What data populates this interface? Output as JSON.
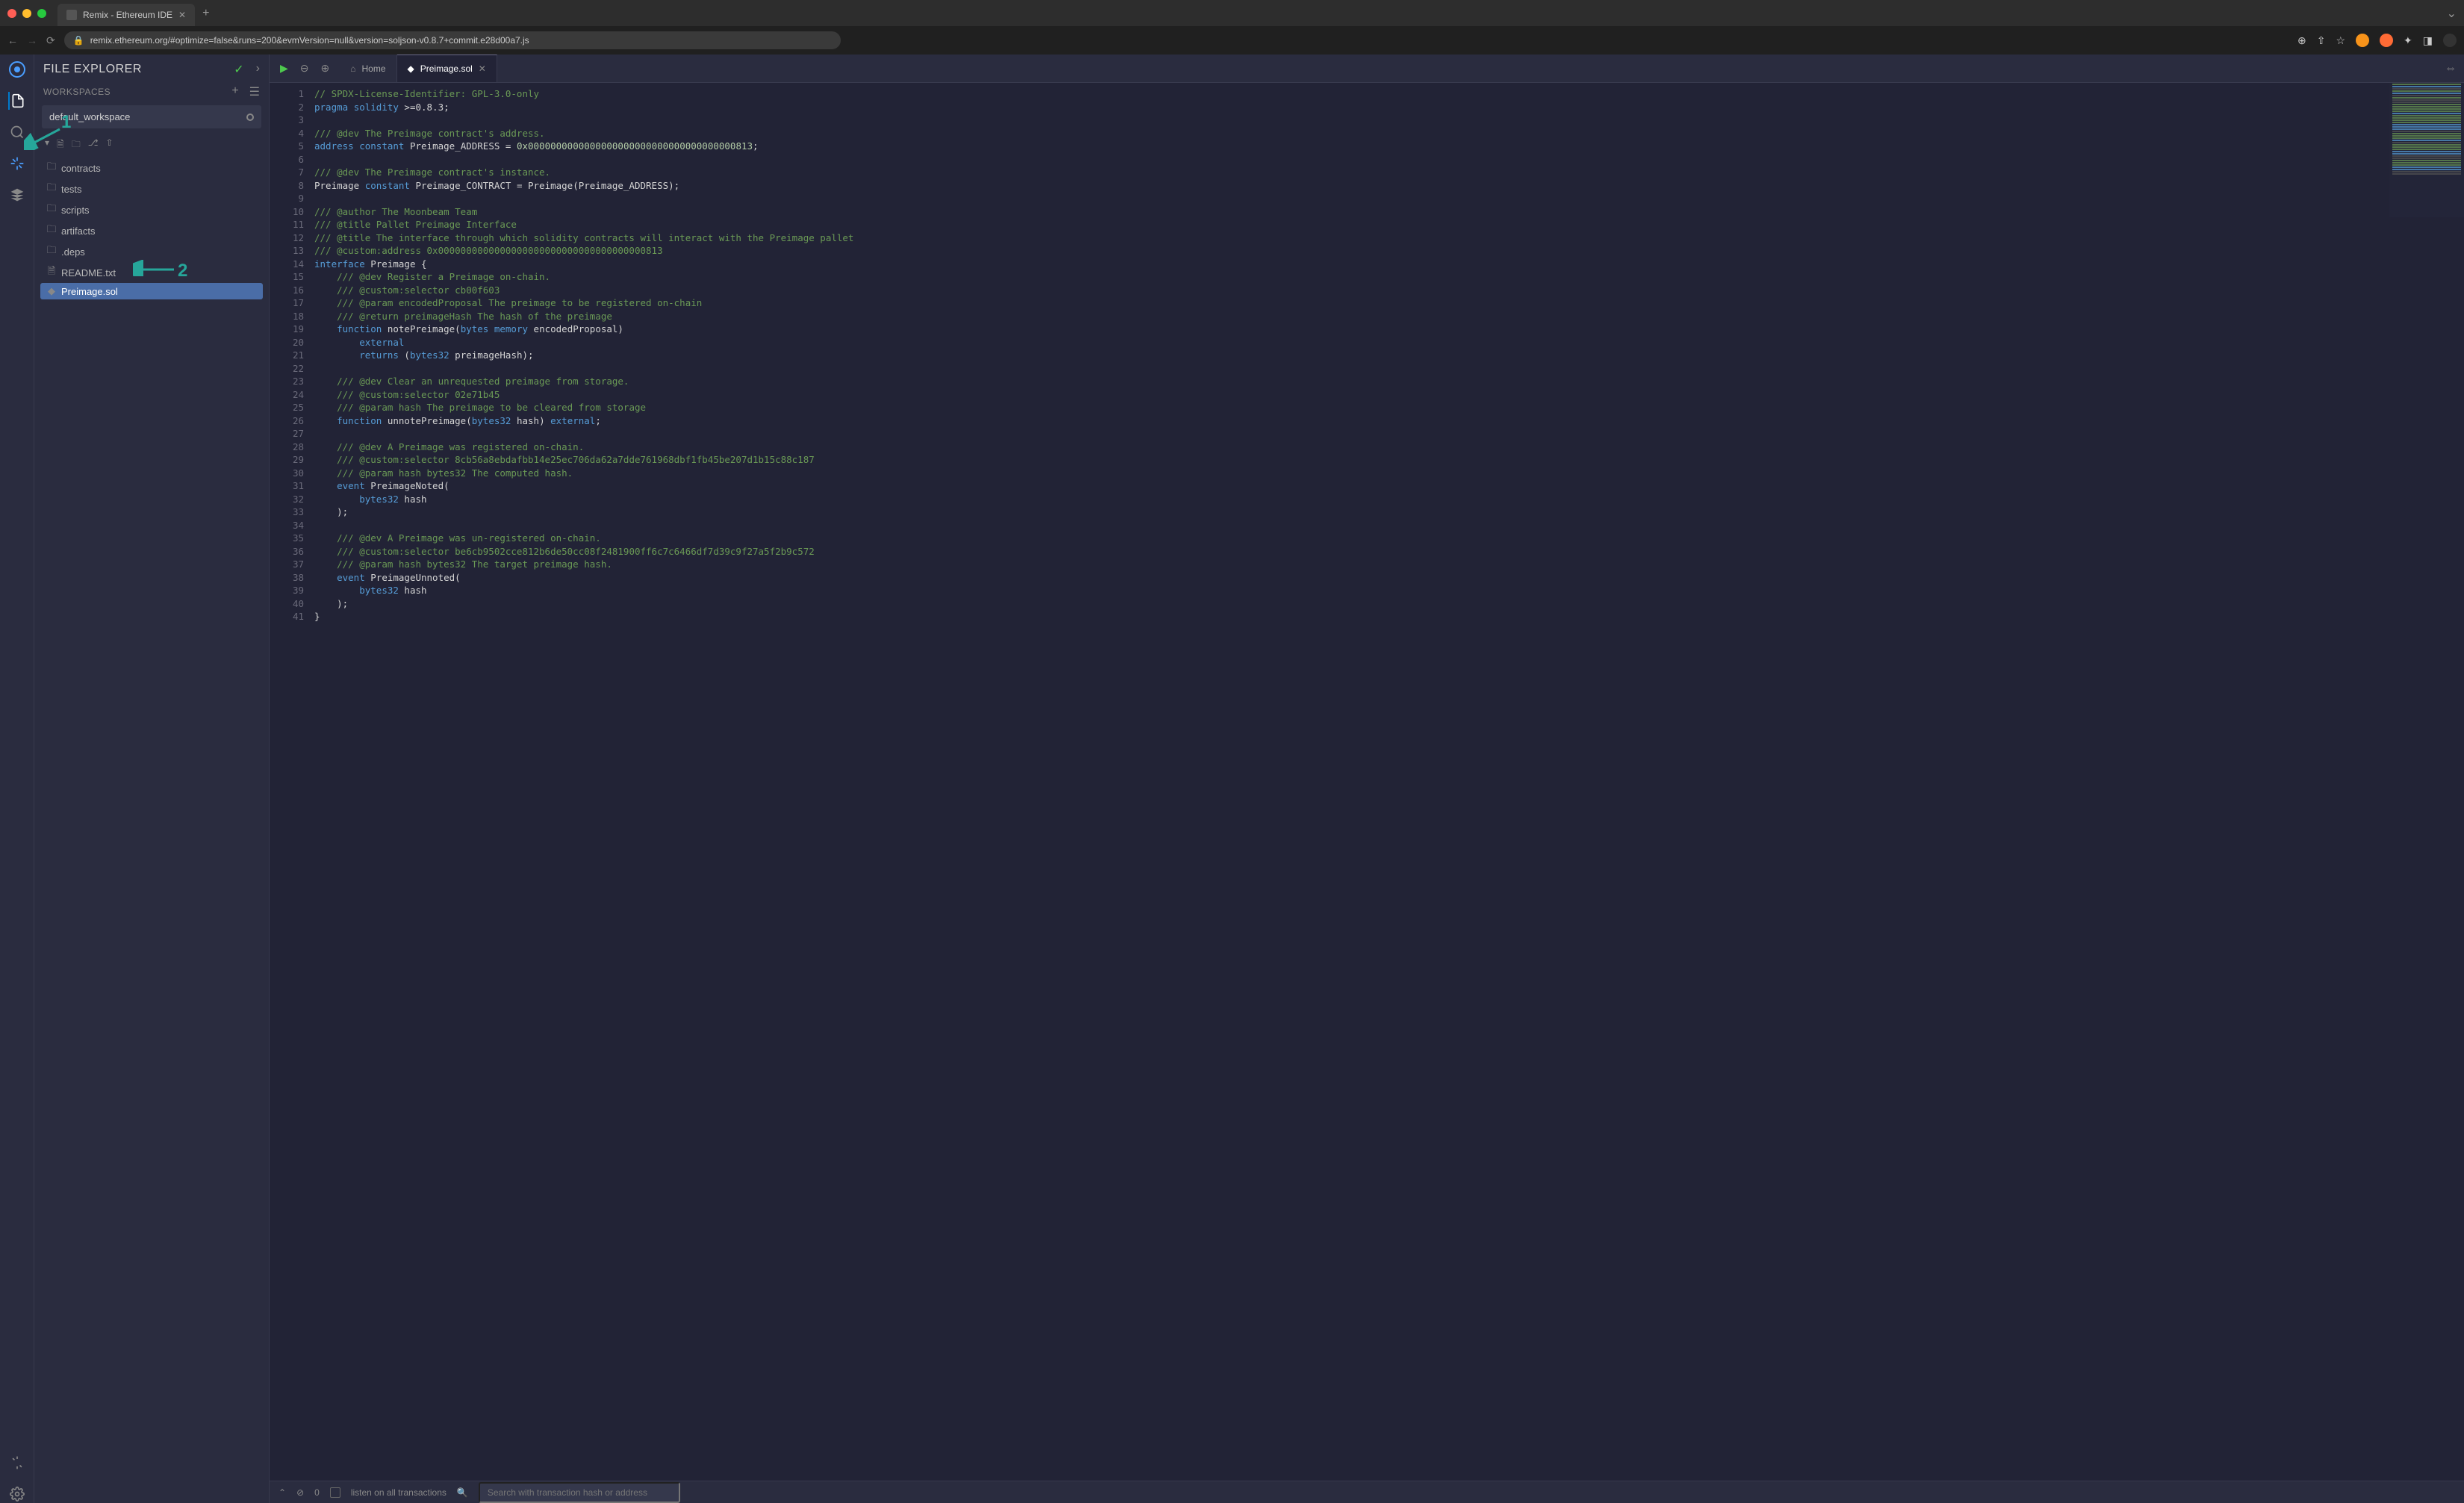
{
  "browser": {
    "tab_title": "Remix - Ethereum IDE",
    "url": "remix.ethereum.org/#optimize=false&runs=200&evmVersion=null&version=soljson-v0.8.7+commit.e28d00a7.js"
  },
  "sidebar": {
    "title": "FILE EXPLORER",
    "workspaces_label": "WORKSPACES",
    "workspace_selected": "default_workspace",
    "files": [
      {
        "name": "contracts",
        "type": "folder"
      },
      {
        "name": "tests",
        "type": "folder"
      },
      {
        "name": "scripts",
        "type": "folder"
      },
      {
        "name": "artifacts",
        "type": "folder"
      },
      {
        "name": ".deps",
        "type": "folder"
      },
      {
        "name": "README.txt",
        "type": "file-txt"
      },
      {
        "name": "Preimage.sol",
        "type": "file-sol",
        "selected": true
      }
    ]
  },
  "annotations": {
    "a1": "1",
    "a2": "2"
  },
  "editor": {
    "tabs": [
      {
        "label": "Home",
        "type": "home"
      },
      {
        "label": "Preimage.sol",
        "type": "sol",
        "active": true,
        "closeable": true
      }
    ],
    "code_lines": [
      {
        "n": 1,
        "tokens": [
          [
            "c-comment",
            "// SPDX-License-Identifier: GPL-3.0-only"
          ]
        ]
      },
      {
        "n": 2,
        "tokens": [
          [
            "c-keyword",
            "pragma"
          ],
          [
            "c-default",
            " "
          ],
          [
            "c-keyword",
            "solidity"
          ],
          [
            "c-default",
            " >=0.8.3;"
          ]
        ]
      },
      {
        "n": 3,
        "tokens": []
      },
      {
        "n": 4,
        "tokens": [
          [
            "c-comment",
            "/// @dev The Preimage contract's address."
          ]
        ]
      },
      {
        "n": 5,
        "tokens": [
          [
            "c-keyword",
            "address"
          ],
          [
            "c-default",
            " "
          ],
          [
            "c-keyword",
            "constant"
          ],
          [
            "c-default",
            " Preimage_ADDRESS = "
          ],
          [
            "c-number",
            "0x0000000000000000000000000000000000000813"
          ],
          [
            "c-default",
            ";"
          ]
        ]
      },
      {
        "n": 6,
        "tokens": []
      },
      {
        "n": 7,
        "tokens": [
          [
            "c-comment",
            "/// @dev The Preimage contract's instance."
          ]
        ]
      },
      {
        "n": 8,
        "tokens": [
          [
            "c-default",
            "Preimage "
          ],
          [
            "c-keyword",
            "constant"
          ],
          [
            "c-default",
            " Preimage_CONTRACT = Preimage(Preimage_ADDRESS);"
          ]
        ]
      },
      {
        "n": 9,
        "tokens": []
      },
      {
        "n": 10,
        "tokens": [
          [
            "c-comment",
            "/// @author The Moonbeam Team"
          ]
        ]
      },
      {
        "n": 11,
        "tokens": [
          [
            "c-comment",
            "/// @title Pallet Preimage Interface"
          ]
        ]
      },
      {
        "n": 12,
        "tokens": [
          [
            "c-comment",
            "/// @title The interface through which solidity contracts will interact with the Preimage pallet"
          ]
        ]
      },
      {
        "n": 13,
        "tokens": [
          [
            "c-comment",
            "/// @custom:address 0x0000000000000000000000000000000000000813"
          ]
        ]
      },
      {
        "n": 14,
        "tokens": [
          [
            "c-keyword",
            "interface"
          ],
          [
            "c-default",
            " Preimage {"
          ]
        ]
      },
      {
        "n": 15,
        "tokens": [
          [
            "c-default",
            "    "
          ],
          [
            "c-comment",
            "/// @dev Register a Preimage on-chain."
          ]
        ]
      },
      {
        "n": 16,
        "tokens": [
          [
            "c-default",
            "    "
          ],
          [
            "c-comment",
            "/// @custom:selector cb00f603"
          ]
        ]
      },
      {
        "n": 17,
        "tokens": [
          [
            "c-default",
            "    "
          ],
          [
            "c-comment",
            "/// @param encodedProposal The preimage to be registered on-chain"
          ]
        ]
      },
      {
        "n": 18,
        "tokens": [
          [
            "c-default",
            "    "
          ],
          [
            "c-comment",
            "/// @return preimageHash The hash of the preimage"
          ]
        ]
      },
      {
        "n": 19,
        "tokens": [
          [
            "c-default",
            "    "
          ],
          [
            "c-keyword",
            "function"
          ],
          [
            "c-default",
            " notePreimage("
          ],
          [
            "c-type",
            "bytes"
          ],
          [
            "c-default",
            " "
          ],
          [
            "c-keyword",
            "memory"
          ],
          [
            "c-default",
            " encodedProposal)"
          ]
        ]
      },
      {
        "n": 20,
        "tokens": [
          [
            "c-default",
            "        "
          ],
          [
            "c-keyword",
            "external"
          ]
        ]
      },
      {
        "n": 21,
        "tokens": [
          [
            "c-default",
            "        "
          ],
          [
            "c-keyword",
            "returns"
          ],
          [
            "c-default",
            " ("
          ],
          [
            "c-type",
            "bytes32"
          ],
          [
            "c-default",
            " preimageHash);"
          ]
        ]
      },
      {
        "n": 22,
        "tokens": []
      },
      {
        "n": 23,
        "tokens": [
          [
            "c-default",
            "    "
          ],
          [
            "c-comment",
            "/// @dev Clear an unrequested preimage from storage."
          ]
        ]
      },
      {
        "n": 24,
        "tokens": [
          [
            "c-default",
            "    "
          ],
          [
            "c-comment",
            "/// @custom:selector 02e71b45"
          ]
        ]
      },
      {
        "n": 25,
        "tokens": [
          [
            "c-default",
            "    "
          ],
          [
            "c-comment",
            "/// @param hash The preimage to be cleared from storage"
          ]
        ]
      },
      {
        "n": 26,
        "tokens": [
          [
            "c-default",
            "    "
          ],
          [
            "c-keyword",
            "function"
          ],
          [
            "c-default",
            " unnotePreimage("
          ],
          [
            "c-type",
            "bytes32"
          ],
          [
            "c-default",
            " hash) "
          ],
          [
            "c-keyword",
            "external"
          ],
          [
            "c-default",
            ";"
          ]
        ]
      },
      {
        "n": 27,
        "tokens": []
      },
      {
        "n": 28,
        "tokens": [
          [
            "c-default",
            "    "
          ],
          [
            "c-comment",
            "/// @dev A Preimage was registered on-chain."
          ]
        ]
      },
      {
        "n": 29,
        "tokens": [
          [
            "c-default",
            "    "
          ],
          [
            "c-comment",
            "/// @custom:selector 8cb56a8ebdafbb14e25ec706da62a7dde761968dbf1fb45be207d1b15c88c187"
          ]
        ]
      },
      {
        "n": 30,
        "tokens": [
          [
            "c-default",
            "    "
          ],
          [
            "c-comment",
            "/// @param hash bytes32 The computed hash."
          ]
        ]
      },
      {
        "n": 31,
        "tokens": [
          [
            "c-default",
            "    "
          ],
          [
            "c-keyword",
            "event"
          ],
          [
            "c-default",
            " PreimageNoted("
          ]
        ]
      },
      {
        "n": 32,
        "tokens": [
          [
            "c-default",
            "        "
          ],
          [
            "c-type",
            "bytes32"
          ],
          [
            "c-default",
            " hash"
          ]
        ]
      },
      {
        "n": 33,
        "tokens": [
          [
            "c-default",
            "    );"
          ]
        ]
      },
      {
        "n": 34,
        "tokens": []
      },
      {
        "n": 35,
        "tokens": [
          [
            "c-default",
            "    "
          ],
          [
            "c-comment",
            "/// @dev A Preimage was un-registered on-chain."
          ]
        ]
      },
      {
        "n": 36,
        "tokens": [
          [
            "c-default",
            "    "
          ],
          [
            "c-comment",
            "/// @custom:selector be6cb9502cce812b6de50cc08f2481900ff6c7c6466df7d39c9f27a5f2b9c572"
          ]
        ]
      },
      {
        "n": 37,
        "tokens": [
          [
            "c-default",
            "    "
          ],
          [
            "c-comment",
            "/// @param hash bytes32 The target preimage hash."
          ]
        ]
      },
      {
        "n": 38,
        "tokens": [
          [
            "c-default",
            "    "
          ],
          [
            "c-keyword",
            "event"
          ],
          [
            "c-default",
            " PreimageUnnoted("
          ]
        ]
      },
      {
        "n": 39,
        "tokens": [
          [
            "c-default",
            "        "
          ],
          [
            "c-type",
            "bytes32"
          ],
          [
            "c-default",
            " hash"
          ]
        ]
      },
      {
        "n": 40,
        "tokens": [
          [
            "c-default",
            "    );"
          ]
        ]
      },
      {
        "n": 41,
        "tokens": [
          [
            "c-default",
            "}"
          ]
        ]
      }
    ]
  },
  "terminal": {
    "count": "0",
    "listen_label": "listen on all transactions",
    "search_placeholder": "Search with transaction hash or address"
  }
}
